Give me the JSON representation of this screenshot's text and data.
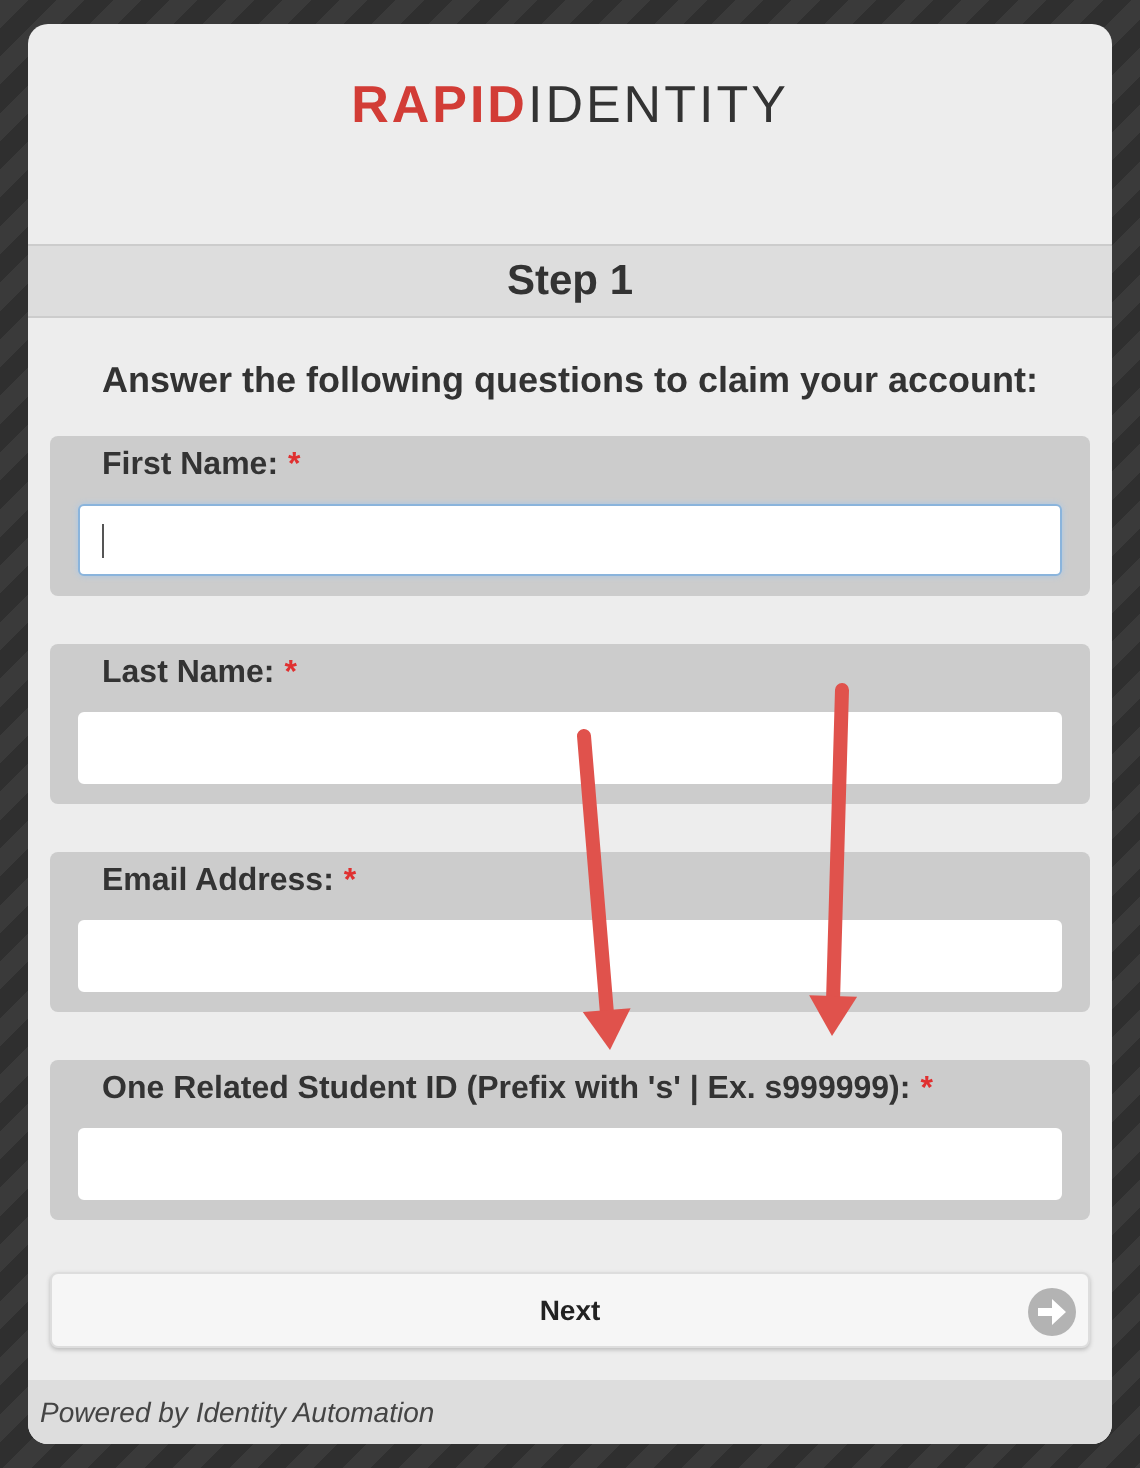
{
  "logo": [
    "RAPID",
    "IDENTITY"
  ],
  "step": "Step 1",
  "heading": "Answer the following questions to claim your account:",
  "fields": [
    {
      "label": "First Name:",
      "required_mark": "*",
      "focused": true
    },
    {
      "label": "Last Name:",
      "required_mark": "*",
      "focused": false
    },
    {
      "label": "Email Address:",
      "required_mark": "*",
      "focused": false
    },
    {
      "label": "One Related Student ID (Prefix with 's' | Ex. s999999):",
      "required_mark": "*",
      "focused": false
    }
  ],
  "next_button": "Next",
  "annotations": [
    {
      "kind": "arrow"
    },
    {
      "kind": "arrow"
    }
  ],
  "footer": "Powered by Identity Automation"
}
